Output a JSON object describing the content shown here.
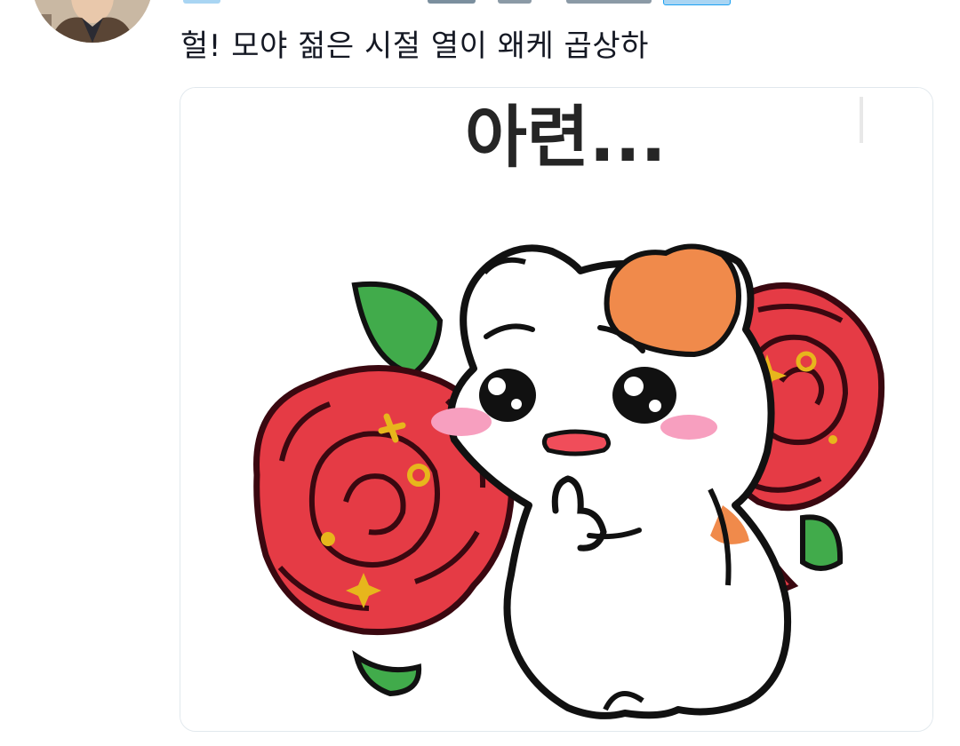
{
  "tweet": {
    "text": "헐! 모야 젊은 시절 열이 왜케 곱상하",
    "avatar_icon": "profile-photo-avatar",
    "accent_color": "#1da1f2",
    "text_color": "#141823"
  },
  "media": {
    "sticker_text": "아련...",
    "icon": "hamster-with-roses-sticker",
    "colors": {
      "rose": "#e53b45",
      "rose_outline": "#4a0a14",
      "leaf": "#3eaa49",
      "patch": "#f08a4b",
      "blush": "#f79fbf",
      "sparkle": "#e7b61c"
    }
  }
}
